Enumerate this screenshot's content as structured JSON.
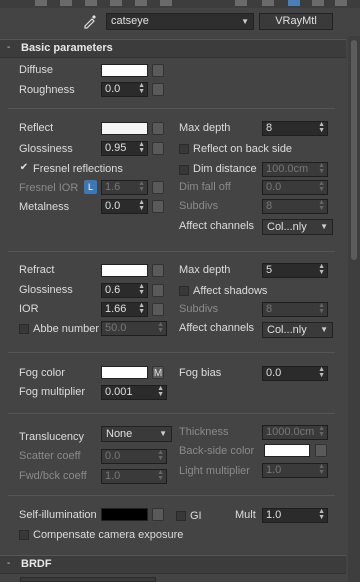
{
  "toolbar": {
    "material_name": "catseye",
    "material_type": "VRayMtl",
    "eyedropper_icon": "eyedropper-icon"
  },
  "rollouts": {
    "basic": "Basic parameters",
    "brdf": "BRDF",
    "collapse_symbol": "-",
    "expand_symbol": "+"
  },
  "diffuse": {
    "label": "Diffuse",
    "color": "#ffffff",
    "roughness_label": "Roughness",
    "roughness": "0.0"
  },
  "reflect": {
    "label": "Reflect",
    "color": "#f5f5f5",
    "glossiness_label": "Glossiness",
    "glossiness": "0.95",
    "fresnel_label": "Fresnel reflections",
    "fresnel_checked": "✔",
    "fresnel_ior_label": "Fresnel IOR",
    "lock_label": "L",
    "fresnel_ior": "1.6",
    "metalness_label": "Metalness",
    "metalness": "0.0",
    "max_depth_label": "Max depth",
    "max_depth": "8",
    "reflect_backside_label": "Reflect on back side",
    "dim_distance_label": "Dim distance",
    "dim_distance": "100.0cm",
    "dim_falloff_label": "Dim fall off",
    "dim_falloff": "0.0",
    "subdivs_label": "Subdivs",
    "subdivs": "8",
    "affect_channels_label": "Affect channels",
    "affect_channels": "Col...nly"
  },
  "refract": {
    "label": "Refract",
    "color": "#ffffff",
    "glossiness_label": "Glossiness",
    "glossiness": "0.6",
    "ior_label": "IOR",
    "ior": "1.66",
    "abbe_label": "Abbe number",
    "abbe": "50.0",
    "max_depth_label": "Max depth",
    "max_depth": "5",
    "affect_shadows_label": "Affect shadows",
    "subdivs_label": "Subdivs",
    "subdivs": "8",
    "affect_channels_label": "Affect channels",
    "affect_channels": "Col...nly"
  },
  "fog": {
    "color_label": "Fog color",
    "color": "#ffffff",
    "map_label": "M",
    "multiplier_label": "Fog multiplier",
    "multiplier": "0.001",
    "bias_label": "Fog bias",
    "bias": "0.0"
  },
  "translucency": {
    "label": "Translucency",
    "mode": "None",
    "scatter_label": "Scatter coeff",
    "scatter": "0.0",
    "fwd_label": "Fwd/bck coeff",
    "fwd": "1.0",
    "thickness_label": "Thickness",
    "thickness": "1000.0cm",
    "backside_label": "Back-side color",
    "backside_color": "#ffffff",
    "light_mult_label": "Light multiplier",
    "light_mult": "1.0"
  },
  "self_illum": {
    "label": "Self-illumination",
    "color": "#000000",
    "gi_label": "GI",
    "mult_label": "Mult",
    "mult": "1.0",
    "compensate_label": "Compensate camera exposure"
  }
}
